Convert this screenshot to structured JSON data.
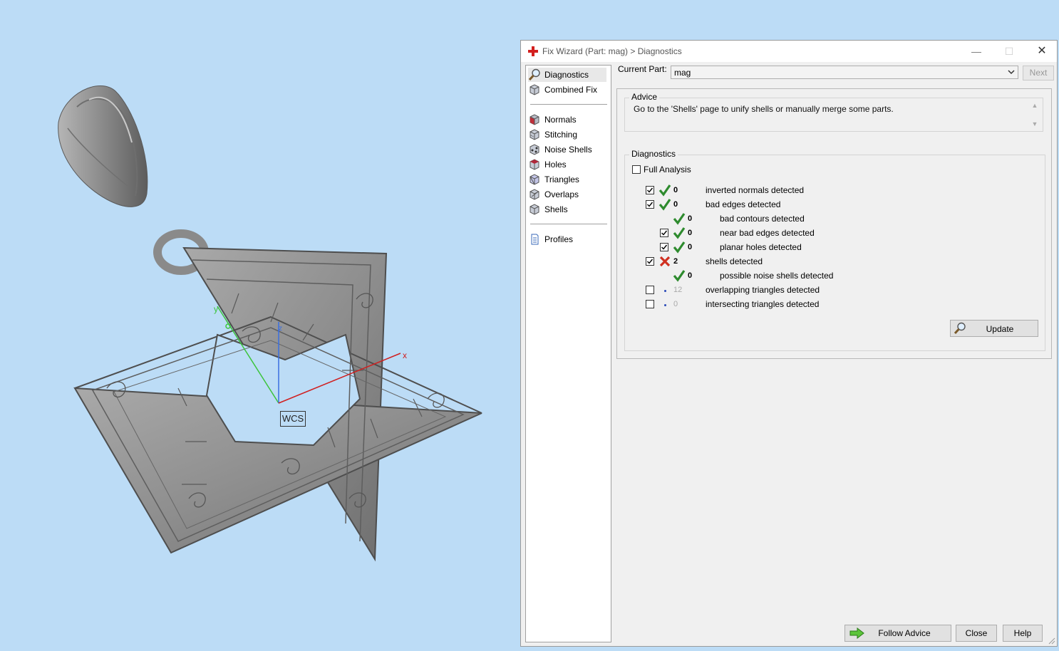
{
  "viewport": {
    "wcs_label": "WCS",
    "axis_x": "x",
    "axis_y": "y",
    "axis_z": "z"
  },
  "window": {
    "title": "Fix Wizard (Part: mag) > Diagnostics",
    "minimize": "—",
    "maximize": "☐",
    "close": "✕"
  },
  "nav": {
    "items": [
      {
        "label": "Diagnostics",
        "icon": "magnifier-icon",
        "selected": true
      },
      {
        "label": "Combined Fix",
        "icon": "cube-icon"
      },
      {
        "label": "Normals",
        "icon": "normals-cube-icon"
      },
      {
        "label": "Stitching",
        "icon": "stitching-cube-icon"
      },
      {
        "label": "Noise Shells",
        "icon": "noise-shells-icon"
      },
      {
        "label": "Holes",
        "icon": "holes-cube-icon"
      },
      {
        "label": "Triangles",
        "icon": "triangles-cube-icon"
      },
      {
        "label": "Overlaps",
        "icon": "overlaps-cube-icon"
      },
      {
        "label": "Shells",
        "icon": "shells-cube-icon"
      },
      {
        "label": "Profiles",
        "icon": "profiles-doc-icon"
      }
    ]
  },
  "current_part": {
    "label": "Current Part:",
    "value": "mag"
  },
  "next_label": "Next",
  "advice": {
    "title": "Advice",
    "text": "Go to the 'Shells' page to unify shells or manually merge some parts."
  },
  "diagnostics": {
    "title": "Diagnostics",
    "full_analysis_label": "Full Analysis",
    "full_analysis_checked": false,
    "rows": [
      {
        "checked": true,
        "status": "ok",
        "count": "0",
        "label": "inverted normals detected"
      },
      {
        "checked": true,
        "status": "ok",
        "count": "0",
        "label": "bad edges detected"
      },
      {
        "checked": null,
        "status": "ok",
        "count": "0",
        "label": "bad contours detected"
      },
      {
        "checked": true,
        "status": "ok",
        "count": "0",
        "label": "near bad edges detected"
      },
      {
        "checked": true,
        "status": "ok",
        "count": "0",
        "label": "planar holes detected"
      },
      {
        "checked": true,
        "status": "error",
        "count": "2",
        "label": "shells detected"
      },
      {
        "checked": null,
        "status": "ok",
        "count": "0",
        "label": "possible noise shells detected"
      },
      {
        "checked": false,
        "status": "none",
        "count": "12",
        "label": "overlapping triangles detected"
      },
      {
        "checked": false,
        "status": "none",
        "count": "0",
        "label": "intersecting triangles detected"
      }
    ],
    "update_label": "Update"
  },
  "buttons": {
    "follow_advice": "Follow Advice",
    "close": "Close",
    "help": "Help"
  },
  "colors": {
    "viewport_bg": "#bcdcf6",
    "ok_green": "#2e8b2e",
    "error_red": "#d03020",
    "model_gray": "#8a8a8a"
  }
}
